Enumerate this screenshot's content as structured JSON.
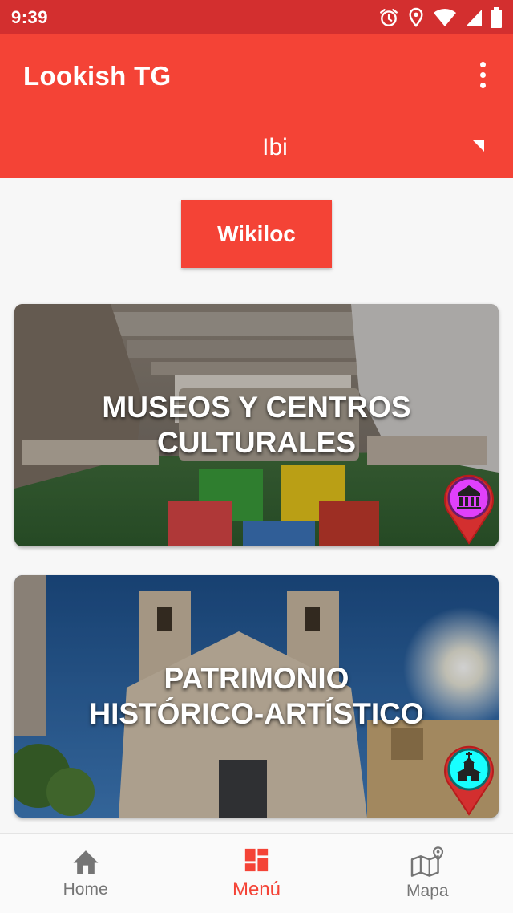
{
  "status_bar": {
    "time": "9:39",
    "icons": [
      "alarm-icon",
      "location-icon",
      "wifi-icon",
      "signal-icon",
      "battery-icon"
    ]
  },
  "app_bar": {
    "title": "Lookish TG",
    "menu_icon": "more-vert-icon",
    "city_selector": {
      "selected": "Ibi"
    }
  },
  "wikiloc_button": {
    "label": "Wikiloc"
  },
  "cards": [
    {
      "title": "MUSEOS Y CENTROS CULTURALES",
      "pin_icon": "museum-icon",
      "pin_color": "#e040fb"
    },
    {
      "title_line1": "PATRIMONIO",
      "title_line2": "HISTÓRICO-ARTÍSTICO",
      "pin_icon": "church-icon",
      "pin_color": "#18ffff"
    }
  ],
  "bottom_nav": {
    "items": [
      {
        "label": "Home",
        "icon": "home-icon",
        "active": false
      },
      {
        "label": "Menú",
        "icon": "dashboard-icon",
        "active": true
      },
      {
        "label": "Mapa",
        "icon": "map-icon",
        "active": false
      }
    ]
  },
  "colors": {
    "status_bar": "#d32f2f",
    "primary": "#f44336",
    "inactive": "#757575"
  }
}
